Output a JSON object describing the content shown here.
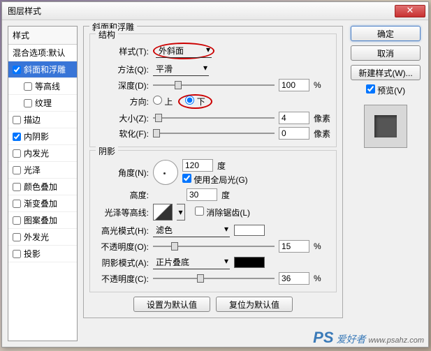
{
  "title": "图层样式",
  "sidebar": {
    "header": "样式",
    "items": [
      {
        "label": "混合选项:默认",
        "checked": null
      },
      {
        "label": "斜面和浮雕",
        "checked": true,
        "selected": true
      },
      {
        "label": "等高线",
        "checked": false,
        "indent": true
      },
      {
        "label": "纹理",
        "checked": false,
        "indent": true
      },
      {
        "label": "描边",
        "checked": false
      },
      {
        "label": "内阴影",
        "checked": true
      },
      {
        "label": "内发光",
        "checked": false
      },
      {
        "label": "光泽",
        "checked": false
      },
      {
        "label": "颜色叠加",
        "checked": false
      },
      {
        "label": "渐变叠加",
        "checked": false
      },
      {
        "label": "图案叠加",
        "checked": false
      },
      {
        "label": "外发光",
        "checked": false
      },
      {
        "label": "投影",
        "checked": false
      }
    ]
  },
  "main_title": "斜面和浮雕",
  "structure": {
    "title": "结构",
    "style_label": "样式(T):",
    "style_value": "外斜面",
    "method_label": "方法(Q):",
    "method_value": "平滑",
    "depth_label": "深度(D):",
    "depth_value": "100",
    "depth_unit": "%",
    "direction_label": "方向:",
    "up_label": "上",
    "down_label": "下",
    "direction_value": "down",
    "size_label": "大小(Z):",
    "size_value": "4",
    "size_unit": "像素",
    "soften_label": "软化(F):",
    "soften_value": "0",
    "soften_unit": "像素"
  },
  "shading": {
    "title": "阴影",
    "angle_label": "角度(N):",
    "angle_value": "120",
    "angle_unit": "度",
    "global_label": "使用全局光(G)",
    "global_checked": true,
    "altitude_label": "高度:",
    "altitude_value": "30",
    "altitude_unit": "度",
    "gloss_label": "光泽等高线:",
    "antialias_label": "消除锯齿(L)",
    "antialias_checked": false,
    "highlight_mode_label": "高光模式(H):",
    "highlight_mode_value": "滤色",
    "highlight_opacity_label": "不透明度(O):",
    "highlight_opacity_value": "15",
    "highlight_opacity_unit": "%",
    "shadow_mode_label": "阴影模式(A):",
    "shadow_mode_value": "正片叠底",
    "shadow_opacity_label": "不透明度(C):",
    "shadow_opacity_value": "36",
    "shadow_opacity_unit": "%"
  },
  "bottom": {
    "default_btn": "设置为默认值",
    "reset_btn": "复位为默认值"
  },
  "right": {
    "ok": "确定",
    "cancel": "取消",
    "new_style": "新建样式(W)...",
    "preview_label": "预览(V)",
    "preview_checked": true
  },
  "watermark": {
    "ps": "PS",
    "cn": "爱好者",
    "url": "www.psahz.com"
  }
}
